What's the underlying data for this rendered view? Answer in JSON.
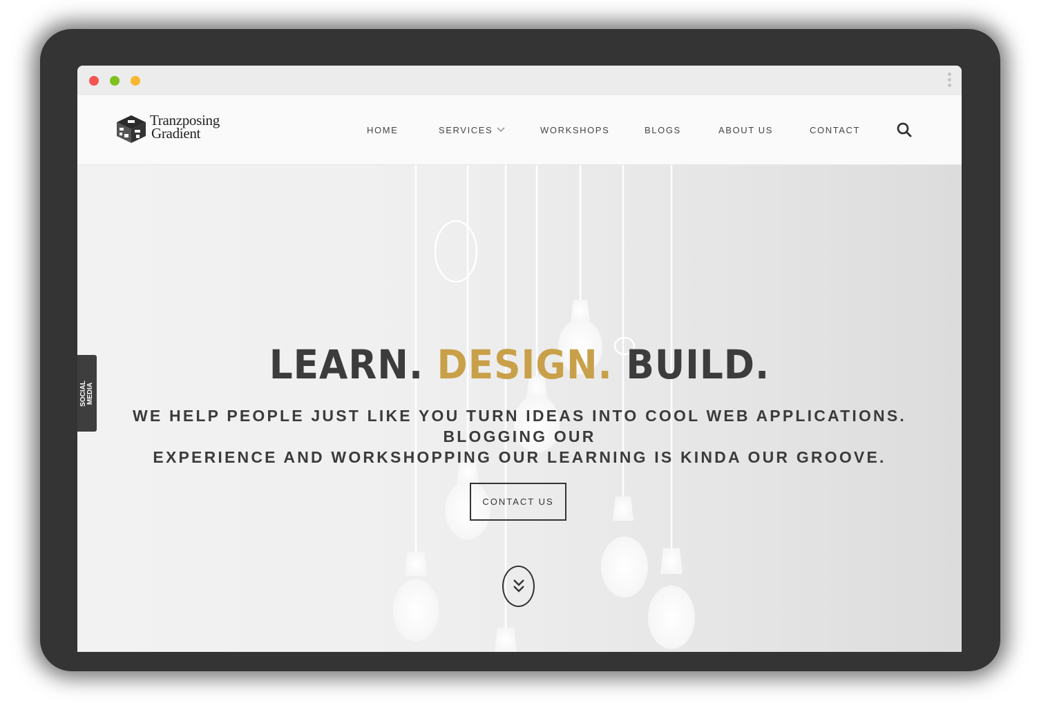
{
  "window": {
    "controls": [
      "close-dot",
      "minimize-dot",
      "maximize-dot"
    ],
    "menu_icon": "kebab-menu-icon"
  },
  "header": {
    "logo": {
      "line1": "Tranzposing",
      "line2": "Gradient",
      "icon": "cube-logo-icon"
    },
    "nav": [
      {
        "label": "HOME"
      },
      {
        "label": "SERVICES",
        "has_dropdown": true,
        "icon": "chevron-down-icon"
      },
      {
        "label": "WORKSHOPS"
      },
      {
        "label": "BLOGS"
      },
      {
        "label": "ABOUT US"
      },
      {
        "label": "CONTACT"
      }
    ],
    "search_icon": "search-icon"
  },
  "social_tab": {
    "line1": "SOCIAL",
    "line2": "MEDIA"
  },
  "hero": {
    "headline": {
      "part1": "LEARN.",
      "part2": "DESIGN.",
      "part3": "BUILD."
    },
    "subtitle_line1": "WE HELP PEOPLE JUST LIKE YOU TURN IDEAS INTO COOL WEB APPLICATIONS. BLOGGING OUR",
    "subtitle_line2": "EXPERIENCE AND WORKSHOPPING OUR LEARNING IS KINDA OUR GROOVE.",
    "cta_label": "CONTACT US",
    "scroll_icon": "double-chevron-down-icon"
  },
  "colors": {
    "accent": "#c9a04a",
    "text_dark": "#3c3c3c",
    "social_tab_bg": "#3e3e3e",
    "close": "#f45452",
    "minimize": "#7ec01e",
    "maximize": "#f7b731"
  }
}
